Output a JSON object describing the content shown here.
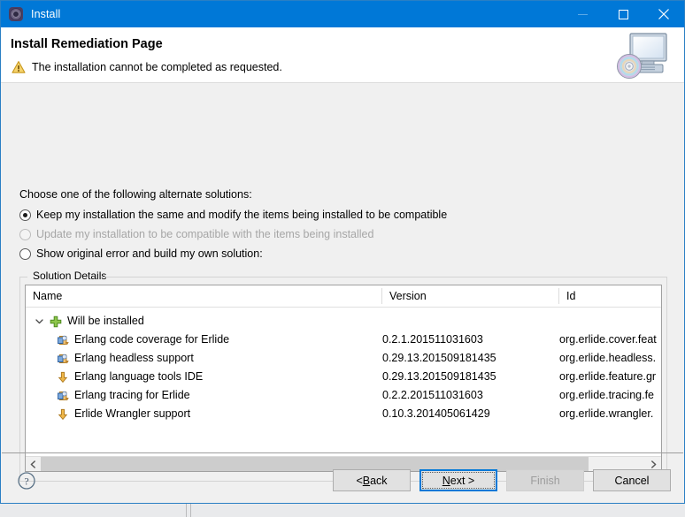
{
  "window": {
    "title": "Install",
    "title_icon": "gear-icon",
    "minimize_label": "Minimize",
    "maximize_label": "Maximize",
    "close_label": "Close",
    "accent_color": "#0078d7",
    "titlebar_text_color": "#ffffff",
    "body_background": "#f0f0f0"
  },
  "header": {
    "title": "Install Remediation Page",
    "message": "The installation cannot be completed as requested.",
    "message_icon": "warning-icon",
    "banner_icon": "computer-with-disc-icon"
  },
  "main": {
    "intro": "Choose one of the following alternate solutions:",
    "options": [
      {
        "label": "Keep my installation the same and modify the items being installed to be compatible",
        "selected": true,
        "disabled": false
      },
      {
        "label": "Update my installation to be compatible with the items being installed",
        "selected": false,
        "disabled": true
      },
      {
        "label": "Show original error and build my own solution:",
        "selected": false,
        "disabled": false
      }
    ]
  },
  "solution_details": {
    "group_label": "Solution Details",
    "columns": [
      "Name",
      "Version",
      "Id"
    ],
    "group_row": {
      "label": "Will be installed",
      "icon": "green-plus-icon",
      "expanded": true,
      "twisty": "chevron-down-icon"
    },
    "rows": [
      {
        "name": "Erlang code coverage for Erlide",
        "version": "0.2.1.201511031603",
        "id": "org.erlide.cover.feat",
        "icon": "feature-plugin-icon"
      },
      {
        "name": "Erlang headless support",
        "version": "0.29.13.201509181435",
        "id": "org.erlide.headless.",
        "icon": "feature-plugin-icon"
      },
      {
        "name": "Erlang language tools IDE",
        "version": "0.29.13.201509181435",
        "id": "org.erlide.feature.gr",
        "icon": "download-arrow-icon"
      },
      {
        "name": "Erlang tracing for Erlide",
        "version": "0.2.2.201511031603",
        "id": "org.erlide.tracing.fe",
        "icon": "feature-plugin-icon"
      },
      {
        "name": "Erlide Wrangler support",
        "version": "0.10.3.201405061429",
        "id": "org.erlide.wrangler.",
        "icon": "download-arrow-icon"
      }
    ],
    "scrollbar": {
      "left_arrow": "chevron-left-icon",
      "right_arrow": "chevron-right-icon"
    }
  },
  "footer": {
    "help_icon": "help-question-icon",
    "buttons": [
      {
        "label": "< Back",
        "mnemonic": "B",
        "state": "normal"
      },
      {
        "label": "Next >",
        "mnemonic": "N",
        "state": "default"
      },
      {
        "label": "Finish",
        "mnemonic": "",
        "state": "disabled"
      },
      {
        "label": "Cancel",
        "mnemonic": "",
        "state": "normal"
      }
    ]
  }
}
